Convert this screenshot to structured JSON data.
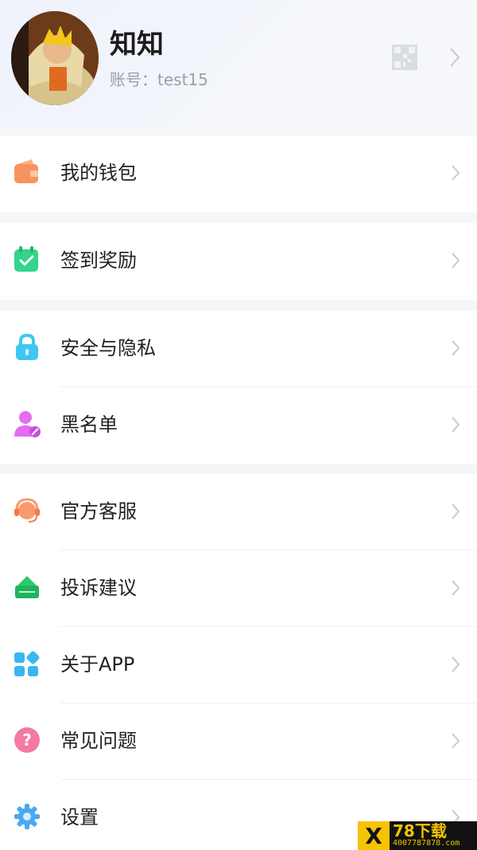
{
  "profile": {
    "nickname": "知知",
    "account": "账号：test15"
  },
  "menu": {
    "wallet": "我的钱包",
    "checkin": "签到奖励",
    "security": "安全与隐私",
    "blacklist": "黑名单",
    "service": "官方客服",
    "feedback": "投诉建议",
    "about": "关于APP",
    "faq": "常见问题",
    "settings": "设置"
  },
  "watermark": {
    "brand": "78下载",
    "phone": "4007787878.com"
  },
  "colors": {
    "wallet": "#f7935c",
    "checkin": "#33d48b",
    "security": "#3ec7f2",
    "blacklist": "#e46bf2",
    "service": "#f79a6e",
    "feedback": "#2fc96c",
    "about": "#3ab6f0",
    "faq": "#f37aa3",
    "settings": "#49a9f5"
  }
}
